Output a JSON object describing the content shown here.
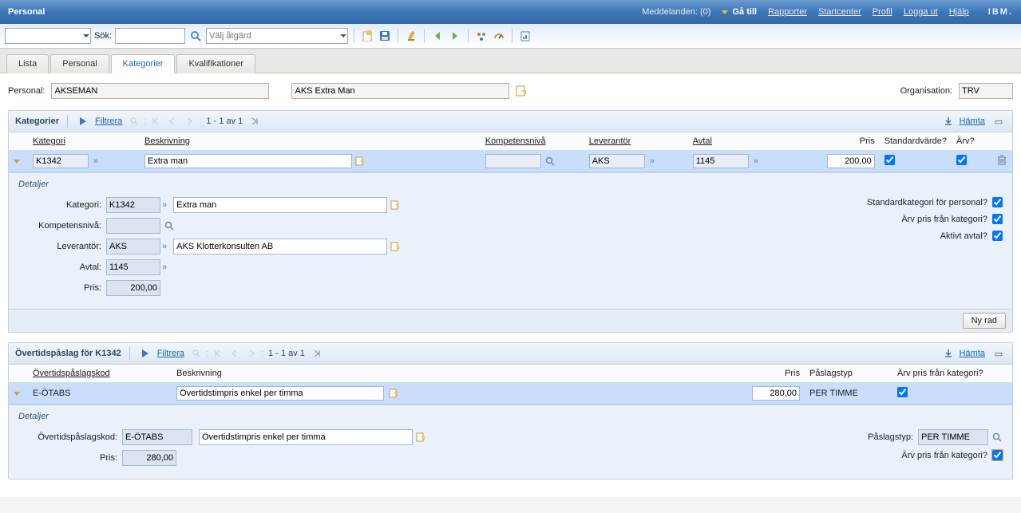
{
  "header": {
    "app_title": "Personal",
    "messages_label": "Meddelanden:",
    "messages_count": "(0)",
    "links": {
      "go_to": "Gå till",
      "reports": "Rapporter",
      "startcenter": "Startcenter",
      "profile": "Profil",
      "logout": "Logga ut",
      "help": "Hjälp"
    },
    "ibm": "IBM."
  },
  "toolbar": {
    "search_label": "Sök:",
    "action_placeholder": "Välj åtgärd"
  },
  "tabs": {
    "list": "Lista",
    "personal": "Personal",
    "categories": "Kategorier",
    "qualifications": "Kvalifikationer"
  },
  "record": {
    "personal_label": "Personal:",
    "personal_value": "AKSEMAN",
    "personal_desc": "AKS Extra Man",
    "org_label": "Organisation:",
    "org_value": "TRV"
  },
  "cat_section": {
    "title": "Kategorier",
    "filter": "Filtrera",
    "pager": "1 - 1 av 1",
    "download": "Hämta",
    "columns": {
      "category": "Kategori",
      "description": "Beskrivning",
      "competence": "Kompetensnivå",
      "supplier": "Leverantör",
      "contract": "Avtal",
      "price": "Pris",
      "default": "Standardvärde?",
      "inherit": "Ärv?"
    },
    "rows": [
      {
        "category": "K1342",
        "description": "Extra man",
        "competence": "",
        "supplier": "AKS",
        "contract": "1145",
        "price": "200,00",
        "default": true,
        "inherit": true
      }
    ],
    "details": {
      "title": "Detaljer",
      "category_label": "Kategori:",
      "competence_label": "Kompetensnivå:",
      "supplier_label": "Leverantör:",
      "supplier_desc": "AKS Klotterkonsulten AB",
      "contract_label": "Avtal:",
      "price_label": "Pris:",
      "std_personal_label": "Standardkategori för personal?",
      "inherit_price_label": "Ärv pris från kategori?",
      "active_contract_label": "Aktivt avtal?",
      "std_personal": true,
      "inherit_price": true,
      "active_contract": true
    },
    "new_row": "Ny rad"
  },
  "ot_section": {
    "title_prefix": "Övertidspåslag för",
    "title_id": "K1342",
    "filter": "Filtrera",
    "pager": "1 - 1 av 1",
    "download": "Hämta",
    "columns": {
      "code": "Övertidspåslagskod",
      "description": "Beskrivning",
      "price": "Pris",
      "type": "Påslagstyp",
      "inherit": "Ärv pris från kategori?"
    },
    "rows": [
      {
        "code": "E-ÖTABS",
        "description": "Övertidstimpris enkel per timma",
        "price": "280,00",
        "type": "PER TIMME",
        "inherit": true
      }
    ],
    "details": {
      "title": "Detaljer",
      "code_label": "Övertidspåslagskod:",
      "price_label": "Pris:",
      "type_label": "Påslagstyp:",
      "inherit_label": "Ärv pris från kategori?",
      "inherit": true
    }
  }
}
